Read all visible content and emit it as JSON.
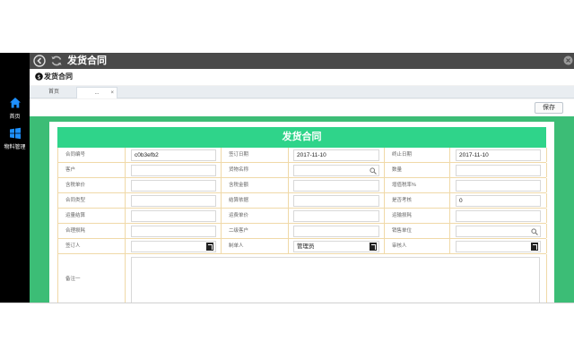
{
  "window": {
    "title": "发货合同"
  },
  "page": {
    "header": "发货合同"
  },
  "sidebar": {
    "items": [
      {
        "label": "首页",
        "icon": "home-icon"
      },
      {
        "label": "物料管理",
        "icon": "windows-icon"
      }
    ]
  },
  "tabs": [
    {
      "label": "首页"
    },
    {
      "label": "...",
      "close": "×"
    }
  ],
  "toolbar": {
    "save_label": "保存"
  },
  "form": {
    "title": "发货合同",
    "rows": [
      [
        {
          "label": "合同编号",
          "value": "c0b3efb2"
        },
        {
          "label": "签订日期",
          "value": "2017-11-10"
        },
        {
          "label": "终止日期",
          "value": "2017-11-10"
        }
      ],
      [
        {
          "label": "客户",
          "value": ""
        },
        {
          "label": "货物名称",
          "value": ""
        },
        {
          "label": "数量",
          "value": ""
        }
      ],
      [
        {
          "label": "含税单价",
          "value": ""
        },
        {
          "label": "含税金额",
          "value": ""
        },
        {
          "label": "增值税率%",
          "value": ""
        }
      ],
      [
        {
          "label": "合同类型",
          "value": ""
        },
        {
          "label": "结算依据",
          "value": ""
        },
        {
          "label": "是否考核",
          "value": "0"
        }
      ],
      [
        {
          "label": "运量结算",
          "value": ""
        },
        {
          "label": "运费单价",
          "value": ""
        },
        {
          "label": "运输损耗",
          "value": ""
        }
      ],
      [
        {
          "label": "合理损耗",
          "value": ""
        },
        {
          "label": "二级客户",
          "value": ""
        },
        {
          "label": "销售单位",
          "value": ""
        }
      ],
      [
        {
          "label": "签订人",
          "value": ""
        },
        {
          "label": "制单人",
          "value": "管理员"
        },
        {
          "label": "审核人",
          "value": ""
        }
      ]
    ],
    "remark_label": "备注一",
    "remark_value": ""
  },
  "colors": {
    "sidebar_bg": "#000000",
    "titlebar_bg": "#4a4a4a",
    "content_green": "#3cbd76",
    "header_green": "#2fd48a",
    "grid_line": "#f0d9a8"
  }
}
